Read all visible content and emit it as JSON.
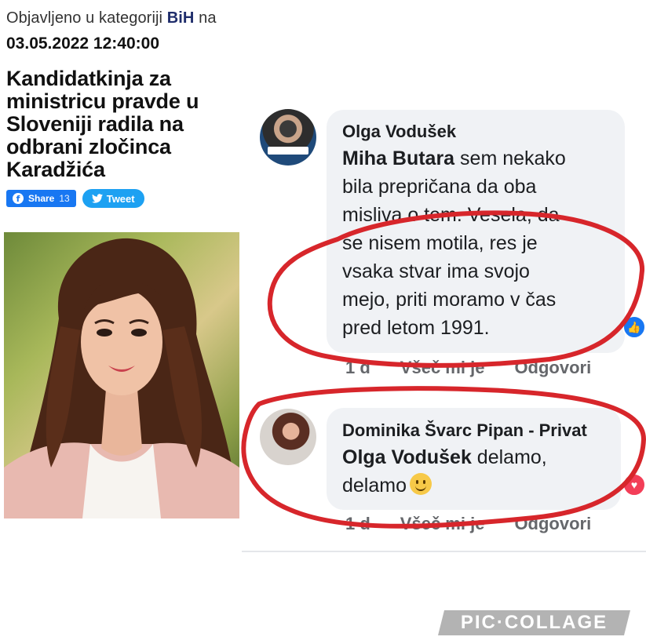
{
  "article": {
    "meta_prefix": "Objavljeno u kategoriji ",
    "category": "BiH",
    "meta_suffix": " na",
    "date": "03.05.2022 12:40:00",
    "headline": "Kandidatkinja za ministricu pravde u Sloveniji radila na odbrani zločinca Karadžića",
    "share": {
      "label": "Share",
      "count": "13",
      "icon": "facebook-icon"
    },
    "tweet": {
      "label": "Tweet",
      "icon": "twitter-bird-icon"
    }
  },
  "comments": [
    {
      "author": "Olga Vodušek",
      "mention": "Miha Butara",
      "lines": [
        " sem nekako",
        "bila prepričana da oba",
        "misliva o tem. Vesela, da",
        "se nisem motila, res je",
        "vsaka stvar ima svojo",
        "mejo, priti moramo v čas",
        "pred letom 1991."
      ],
      "actions": [
        "1 d",
        "Všeč mi je",
        "Odgovori"
      ],
      "reaction": "like"
    },
    {
      "author": "Dominika Švarc Pipan - Privat",
      "mention": "Olga Vodušek",
      "lines": [
        " delamo,",
        "delamo"
      ],
      "actions": [
        "1 d",
        "Všeč mi je",
        "Odgovori"
      ],
      "reaction": "love"
    }
  ],
  "watermark": "PIC·COLLAGE",
  "colors": {
    "category": "#1f2d6b",
    "facebook": "#1877f2",
    "twitter": "#1da1f2",
    "circle_mark": "#d7262b",
    "bubble": "#f0f2f5"
  }
}
